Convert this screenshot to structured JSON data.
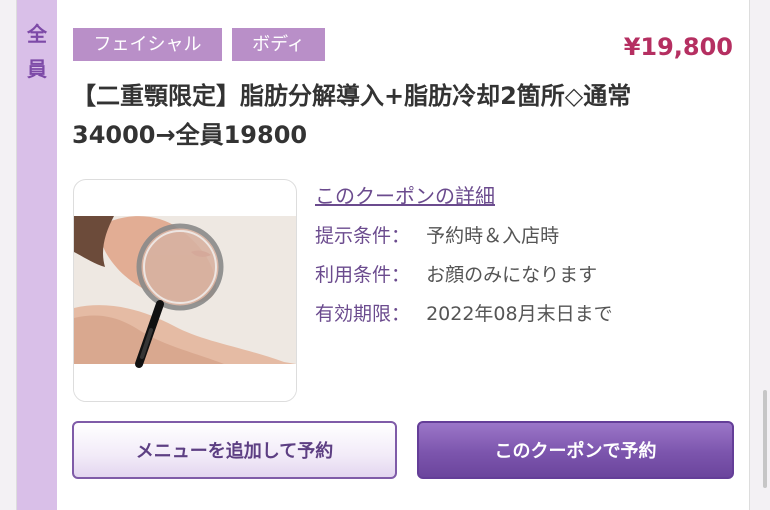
{
  "side_label": {
    "char1": "全",
    "char2": "員"
  },
  "badges": [
    "フェイシャル",
    "ボディ"
  ],
  "price": "¥19,800",
  "title": "【二重顎限定】脂肪分解導入+脂肪冷却2箇所◇通常34000→全員19800",
  "detail_link": "このクーポンの詳細",
  "conditions": [
    {
      "label": "提示条件：",
      "value": "予約時＆入店時"
    },
    {
      "label": "利用条件：",
      "value": "お顔のみになります"
    },
    {
      "label": "有効期限：",
      "value": "2022年08月末日まで"
    }
  ],
  "buttons": {
    "add_menu": "メニューを追加して予約",
    "reserve_coupon": "このクーポンで予約"
  },
  "colors": {
    "accent_purple": "#7c55ad",
    "price_red": "#b52f61",
    "badge_purple": "#b98fc8",
    "side_tag": "#d9bfe8"
  },
  "image": {
    "subject": "woman-chin-magnifier"
  }
}
